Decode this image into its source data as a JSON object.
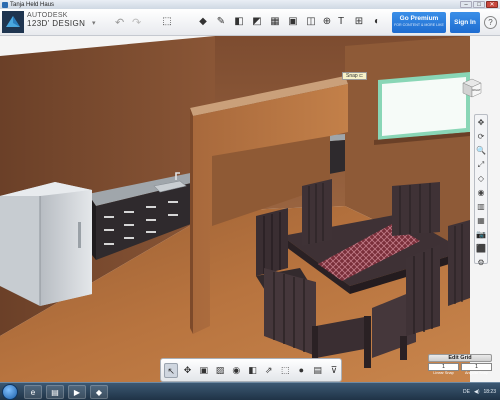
{
  "window": {
    "title": "Tanja Held Haus",
    "minimize": "–",
    "maximize": "□",
    "close": "✕"
  },
  "app": {
    "brand_line1": "AUTODESK",
    "brand_line2": "123D' DESIGN",
    "menu_arrow": "▾",
    "undo": "↶",
    "redo": "↷"
  },
  "toolbar_icons": [
    "transform-icon",
    "primitives-icon",
    "sketch-icon",
    "construct-icon",
    "modify-icon",
    "pattern-icon",
    "grouping-icon",
    "combine-icon",
    "measure-icon",
    "text-icon",
    "snap-icon",
    "material-icon"
  ],
  "toolbar_glyphs": [
    "⬚",
    "◆",
    "✎",
    "◧",
    "◩",
    "▦",
    "▣",
    "◫",
    "⊕",
    "T",
    "⊞",
    "◐"
  ],
  "premium": {
    "label": "Go Premium",
    "sublabel": "FOR CONTENT & MORE LIKE"
  },
  "signin": {
    "label": "Sign In"
  },
  "help": {
    "label": "?"
  },
  "viewport": {
    "tooltip": "Snap ⊏",
    "viewcube_label": "RIGHT"
  },
  "nav_icons": [
    "pan-icon",
    "orbit-icon",
    "zoom-icon",
    "fit-icon",
    "view-icon",
    "eye-icon",
    "materials-icon",
    "grid-icon",
    "screenshot-icon",
    "camera-icon",
    "settings-icon"
  ],
  "nav_glyphs": [
    "✥",
    "⟳",
    "🔍",
    "⤢",
    "◇",
    "◉",
    "▥",
    "▦",
    "📷",
    "⬛",
    "⚙"
  ],
  "bottom_tools": {
    "icons": [
      "select-icon",
      "move-icon",
      "box-select-icon",
      "smart-tool-icon",
      "visibility-icon",
      "layers-icon",
      "export-icon",
      "snapshot-icon",
      "material-icon",
      "display-icon",
      "filter-icon"
    ],
    "glyphs": [
      "↖",
      "✥",
      "▣",
      "▨",
      "◉",
      "◧",
      "⇗",
      "⬚",
      "●",
      "▤",
      "⊽"
    ]
  },
  "grid": {
    "title": "Edit Grid",
    "linear_value": "1",
    "angular_value": "1",
    "linear_label": "Linear Snap",
    "angular_label": "Angular Snap"
  },
  "taskbar": {
    "apps": [
      "ie-icon",
      "explorer-icon",
      "media-icon",
      "app-icon"
    ],
    "app_glyphs": [
      "e",
      "▤",
      "▶",
      "◆"
    ],
    "lang": "DE",
    "time": "18:23",
    "date": ""
  }
}
